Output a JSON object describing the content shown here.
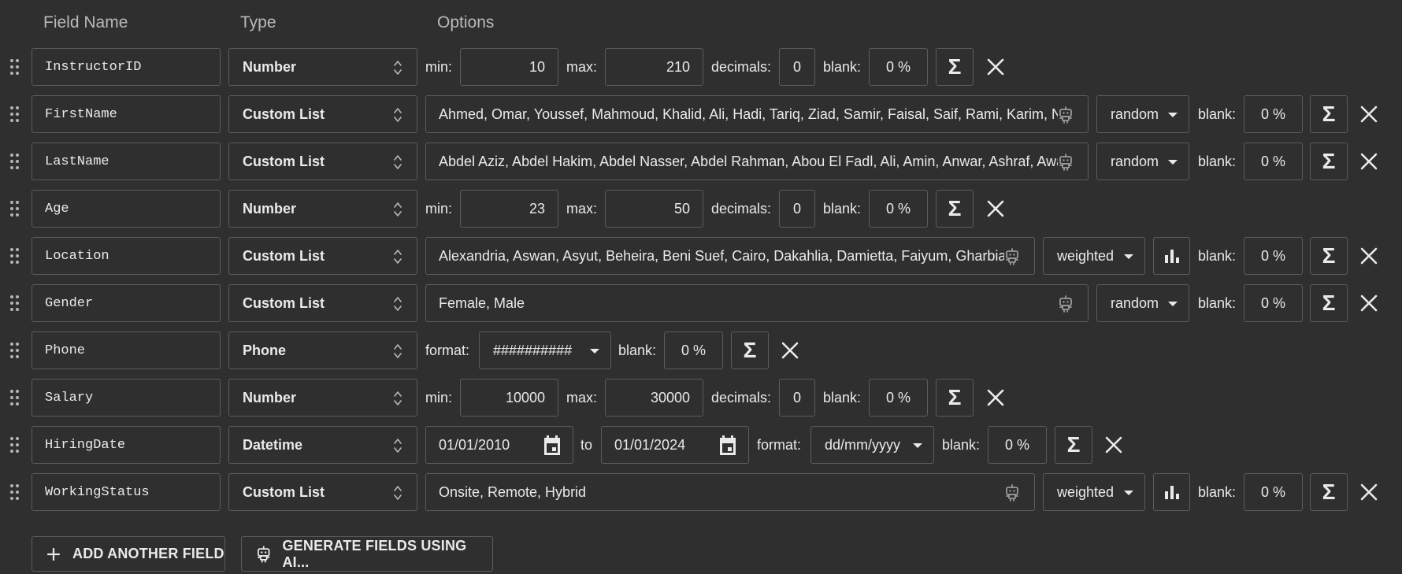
{
  "headers": {
    "field_name": "Field Name",
    "type": "Type",
    "options": "Options"
  },
  "labels": {
    "min": "min:",
    "max": "max:",
    "decimals": "decimals:",
    "blank": "blank:",
    "format": "format:",
    "to": "to",
    "sigma": "Σ"
  },
  "fields": [
    {
      "name": "InstructorID",
      "type": "Number",
      "min": "10",
      "max": "210",
      "decimals": "0",
      "blank": "0 %"
    },
    {
      "name": "FirstName",
      "type": "Custom List",
      "values": "Ahmed, Omar, Youssef, Mahmoud, Khalid, Ali, Hadi, Tariq, Ziad, Samir, Faisal, Saif, Rami, Karim, Nizar",
      "distribution": "random",
      "blank": "0 %"
    },
    {
      "name": "LastName",
      "type": "Custom List",
      "values": "Abdel Aziz, Abdel Hakim, Abdel Nasser, Abdel Rahman, Abou El Fadl, Ali, Amin, Anwar, Ashraf, Awad",
      "distribution": "random",
      "blank": "0 %"
    },
    {
      "name": "Age",
      "type": "Number",
      "min": "23",
      "max": "50",
      "decimals": "0",
      "blank": "0 %"
    },
    {
      "name": "Location",
      "type": "Custom List",
      "values": "Alexandria, Aswan, Asyut, Beheira, Beni Suef, Cairo, Dakahlia, Damietta, Faiyum, Gharbia,",
      "distribution": "weighted",
      "blank": "0 %"
    },
    {
      "name": "Gender",
      "type": "Custom List",
      "values": "Female, Male",
      "distribution": "random",
      "blank": "0 %"
    },
    {
      "name": "Phone",
      "type": "Phone",
      "format": "##########",
      "blank": "0 %"
    },
    {
      "name": "Salary",
      "type": "Number",
      "min": "10000",
      "max": "30000",
      "decimals": "0",
      "blank": "0 %"
    },
    {
      "name": "HiringDate",
      "type": "Datetime",
      "from": "01/01/2010",
      "to": "01/01/2024",
      "format": "dd/mm/yyyy",
      "blank": "0 %"
    },
    {
      "name": "WorkingStatus",
      "type": "Custom List",
      "values": "Onsite, Remote, Hybrid",
      "distribution": "weighted",
      "blank": "0 %"
    }
  ],
  "buttons": {
    "add_field": "ADD ANOTHER FIELD",
    "generate_ai": "GENERATE FIELDS USING AI..."
  },
  "icons": [
    "drag-handle-icon",
    "up-down-arrows-icon",
    "robot-icon",
    "caret-down-icon",
    "bar-chart-icon",
    "sigma-icon",
    "close-icon",
    "calendar-icon",
    "plus-icon"
  ],
  "colors": {
    "background": "#2f2f2f",
    "border": "#5c5c5c",
    "text": "#eaeaea",
    "header": "#b9b9b9"
  }
}
